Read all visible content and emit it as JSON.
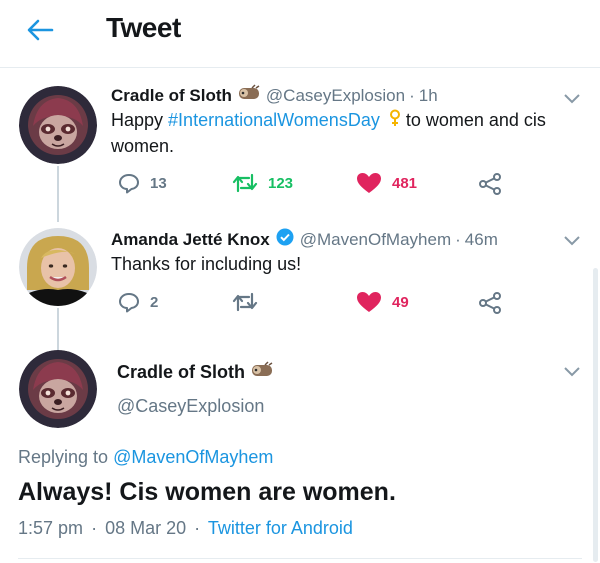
{
  "header": {
    "title": "Tweet",
    "back_icon": "arrow-left-icon"
  },
  "tweets": [
    {
      "name": "Cradle of Sloth",
      "emoji": "sloth-emoji",
      "handle": "@CaseyExplosion",
      "time": "1h",
      "text_before": "Happy ",
      "hashtag": "#InternationalWomensDay",
      "text_emoji": "female-sign-emoji",
      "text_after": " to women and cis women.",
      "replies": "13",
      "retweets": "123",
      "likes": "481",
      "retweeted": true,
      "liked": true
    },
    {
      "name": "Amanda Jetté Knox",
      "verified": true,
      "handle": "@MavenOfMayhem",
      "time": "46m",
      "text": "Thanks for including us!",
      "replies": "2",
      "retweets": "",
      "likes": "49",
      "retweeted": false,
      "liked": true
    }
  ],
  "main_tweet": {
    "name": "Cradle of Sloth",
    "emoji": "sloth-emoji",
    "handle": "@CaseyExplosion",
    "replying_prefix": "Replying to ",
    "replying_to": "@MavenOfMayhem",
    "text": "Always! Cis women are women.",
    "time": "1:57 pm",
    "date": "08 Mar 20",
    "client": "Twitter for Android"
  },
  "separator": "·",
  "colors": {
    "accent": "#1b95e0",
    "retweet": "#17bf63",
    "like": "#e0245e",
    "muted": "#657786",
    "text": "#14171a"
  }
}
